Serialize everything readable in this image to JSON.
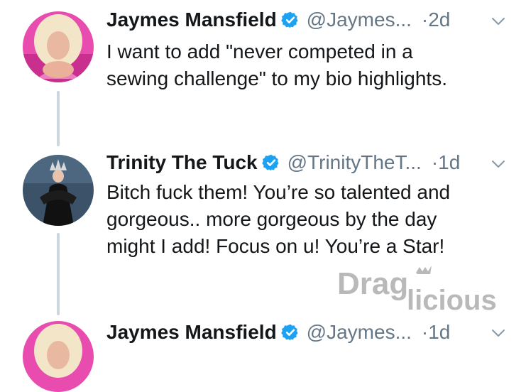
{
  "tweets": [
    {
      "display_name": "Jaymes Mansfield",
      "handle": "@Jaymes...",
      "separator": "·",
      "time": "2d",
      "text": "I want to add \"never competed in a\nsewing challenge\" to my bio highlights.",
      "avatar": "pink-hair-portrait"
    },
    {
      "display_name": "Trinity The Tuck",
      "handle": "@TrinityTheT...",
      "separator": "·",
      "time": "1d",
      "text": "Bitch fuck them! You’re so talented and\ngorgeous.. more gorgeous by the day\nmight I add! Focus on u! You’re a Star!",
      "avatar": "crowned-black-gown-portrait"
    },
    {
      "display_name": "Jaymes Mansfield",
      "handle": "@Jaymes...",
      "separator": "·",
      "time": "1d",
      "text": "",
      "avatar": "pink-hair-portrait"
    }
  ],
  "watermark": {
    "part1": "Drag",
    "part2": "licious"
  },
  "colors": {
    "verified_badge": "#1da1f2",
    "secondary_text": "#657786",
    "thread_line": "#ccd6dd",
    "watermark": "#b9b9b9"
  },
  "icons": {
    "verified": "verified-check-icon",
    "caret": "chevron-down-icon"
  }
}
